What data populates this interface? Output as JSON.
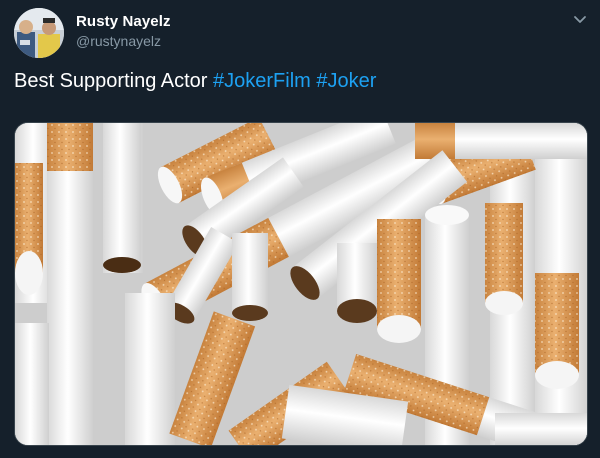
{
  "author": {
    "display_name": "Rusty Nayelz",
    "handle": "@rustynayelz",
    "avatar_icon": "profile-photo"
  },
  "tweet": {
    "text_plain": "Best Supporting Actor ",
    "hashtags": [
      "#JokerFilm",
      "#Joker"
    ],
    "media_alt": "pile of cigarettes photo"
  },
  "menu_icon": "chevron-down-icon",
  "colors": {
    "background": "#15202b",
    "text": "#ffffff",
    "secondary_text": "#8899a6",
    "link": "#1da1f2",
    "filter_tan": "#d99a55",
    "paper_white": "#f1f1f1",
    "tobacco": "#5a3a1e"
  }
}
